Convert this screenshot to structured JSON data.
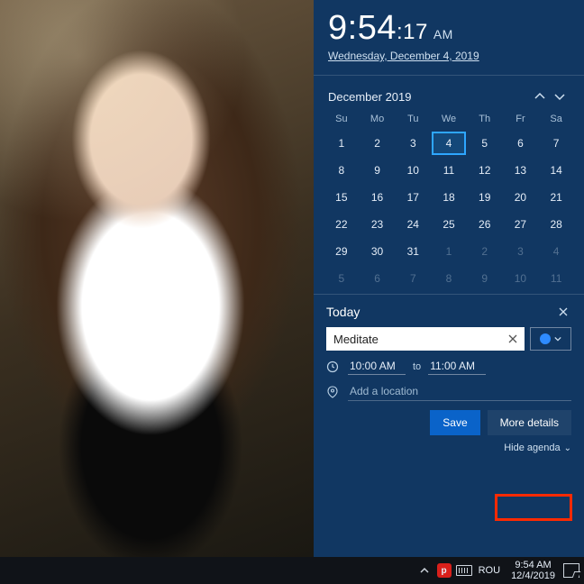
{
  "clock": {
    "hm": "9:54",
    "sec": ":17",
    "ampm": "AM",
    "date_full": "Wednesday, December 4, 2019"
  },
  "calendar": {
    "title": "December 2019",
    "dow": [
      "Su",
      "Mo",
      "Tu",
      "We",
      "Th",
      "Fr",
      "Sa"
    ],
    "days": [
      {
        "n": "1",
        "dim": false
      },
      {
        "n": "2",
        "dim": false
      },
      {
        "n": "3",
        "dim": false
      },
      {
        "n": "4",
        "dim": false,
        "sel": true
      },
      {
        "n": "5",
        "dim": false
      },
      {
        "n": "6",
        "dim": false
      },
      {
        "n": "7",
        "dim": false
      },
      {
        "n": "8",
        "dim": false
      },
      {
        "n": "9",
        "dim": false
      },
      {
        "n": "10",
        "dim": false
      },
      {
        "n": "11",
        "dim": false
      },
      {
        "n": "12",
        "dim": false
      },
      {
        "n": "13",
        "dim": false
      },
      {
        "n": "14",
        "dim": false
      },
      {
        "n": "15",
        "dim": false
      },
      {
        "n": "16",
        "dim": false
      },
      {
        "n": "17",
        "dim": false
      },
      {
        "n": "18",
        "dim": false
      },
      {
        "n": "19",
        "dim": false
      },
      {
        "n": "20",
        "dim": false
      },
      {
        "n": "21",
        "dim": false
      },
      {
        "n": "22",
        "dim": false
      },
      {
        "n": "23",
        "dim": false
      },
      {
        "n": "24",
        "dim": false
      },
      {
        "n": "25",
        "dim": false
      },
      {
        "n": "26",
        "dim": false
      },
      {
        "n": "27",
        "dim": false
      },
      {
        "n": "28",
        "dim": false
      },
      {
        "n": "29",
        "dim": false
      },
      {
        "n": "30",
        "dim": false
      },
      {
        "n": "31",
        "dim": false
      },
      {
        "n": "1",
        "dim": true
      },
      {
        "n": "2",
        "dim": true
      },
      {
        "n": "3",
        "dim": true
      },
      {
        "n": "4",
        "dim": true
      },
      {
        "n": "5",
        "dim": true
      },
      {
        "n": "6",
        "dim": true
      },
      {
        "n": "7",
        "dim": true
      },
      {
        "n": "8",
        "dim": true
      },
      {
        "n": "9",
        "dim": true
      },
      {
        "n": "10",
        "dim": true
      },
      {
        "n": "11",
        "dim": true
      }
    ]
  },
  "agenda": {
    "header": "Today",
    "event_name": "Meditate",
    "start": "10:00 AM",
    "to": "to",
    "end": "11:00 AM",
    "location_placeholder": "Add a location",
    "save_label": "Save",
    "more_label": "More details",
    "hide_label": "Hide agenda"
  },
  "taskbar": {
    "lang": "ROU",
    "time": "9:54 AM",
    "date": "12/4/2019"
  }
}
